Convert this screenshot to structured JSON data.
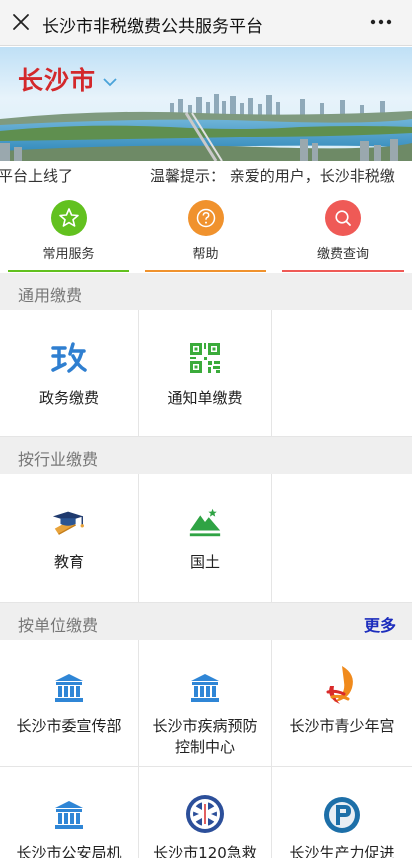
{
  "titlebar": {
    "title": "长沙市非税缴费公共服务平台",
    "close_icon": "close-icon",
    "more_icon": "more-icon"
  },
  "banner": {
    "city": "长沙市",
    "city_color": "#d3282b"
  },
  "notice": {
    "text1": "平台上线了",
    "text2": "温馨提示： 亲爱的用户，长沙非税缴"
  },
  "quick_menu": [
    {
      "label": "常用服务",
      "icon": "star-icon",
      "color": "#62c11f"
    },
    {
      "label": "帮助",
      "icon": "question-icon",
      "color": "#f0922d"
    },
    {
      "label": "缴费查询",
      "icon": "search-icon",
      "color": "#ef5a56"
    }
  ],
  "sections": {
    "general": {
      "title": "通用缴费"
    },
    "industry": {
      "title": "按行业缴费"
    },
    "unit": {
      "title": "按单位缴费",
      "more": "更多"
    }
  },
  "general_items": [
    {
      "label": "政务缴费",
      "icon": "government-icon"
    },
    {
      "label": "通知单缴费",
      "icon": "qrcode-icon"
    }
  ],
  "industry_items": [
    {
      "label": "教育",
      "icon": "graduation-icon"
    },
    {
      "label": "国土",
      "icon": "mountain-icon"
    }
  ],
  "unit_items": [
    {
      "label": "长沙市委宣传部",
      "icon": "bank-icon"
    },
    {
      "label_line1": "长沙市疾病预防",
      "label_line2": "控制中心",
      "icon": "bank-icon"
    },
    {
      "label": "长沙市青少年宫",
      "icon": "youth-palace-logo"
    },
    {
      "label": "长沙市公安局机",
      "icon": "bank-icon"
    },
    {
      "label": "长沙市120急救",
      "icon": "emergency-logo"
    },
    {
      "label": "长沙生产力促进",
      "icon": "productivity-logo"
    }
  ]
}
